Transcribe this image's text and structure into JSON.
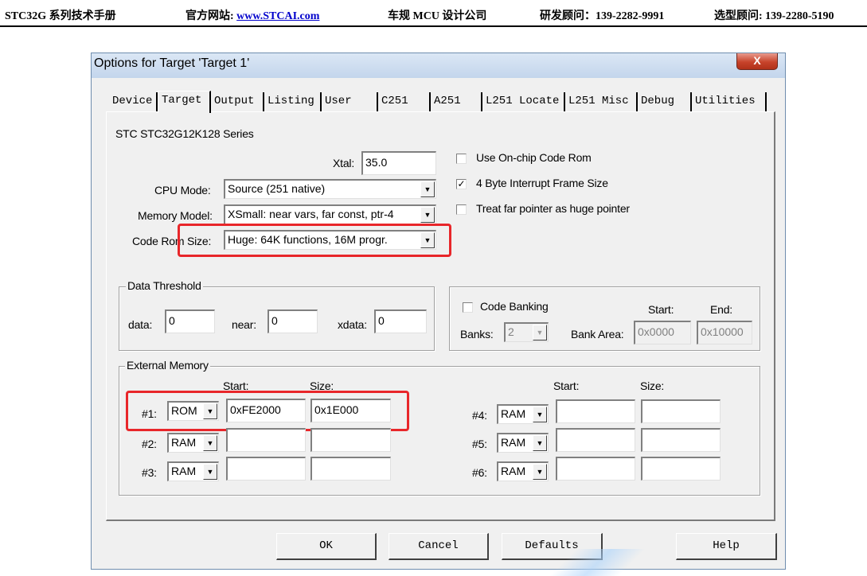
{
  "doc_header": {
    "title": "STC32G 系列技术手册",
    "website_label": "官方网站: ",
    "website_url": "www.STCAI.com",
    "company": "车规 MCU 设计公司",
    "rd_consultant": "研发顾问：139-2282-9991",
    "selection_consultant": "选型顾问: 139-2280-5190"
  },
  "dialog": {
    "title": "Options for Target 'Target 1'",
    "close_label": "X"
  },
  "tabs": [
    {
      "label": "Device"
    },
    {
      "label": "Target",
      "active": true
    },
    {
      "label": "Output"
    },
    {
      "label": "Listing"
    },
    {
      "label": "User"
    },
    {
      "label": "C251"
    },
    {
      "label": "A251"
    },
    {
      "label": "L251 Locate"
    },
    {
      "label": "L251 Misc"
    },
    {
      "label": "Debug"
    },
    {
      "label": "Utilities"
    }
  ],
  "target": {
    "device_name": "STC STC32G12K128 Series",
    "xtal_label": "Xtal:",
    "xtal_value": "35.0",
    "cpu_mode_label": "CPU Mode:",
    "cpu_mode_value": "Source (251 native)",
    "memory_model_label": "Memory Model:",
    "memory_model_value": "XSmall: near vars, far const, ptr-4",
    "code_rom_size_label": "Code Rom Size:",
    "code_rom_size_value": "Huge: 64K functions, 16M progr.",
    "options": {
      "use_onchip_code_rom": {
        "label": "Use On-chip Code Rom",
        "checked": false
      },
      "four_byte_interrupt": {
        "label": "4 Byte Interrupt Frame Size",
        "checked": true
      },
      "treat_far_pointer": {
        "label": "Treat far pointer as huge pointer",
        "checked": false
      }
    },
    "data_threshold": {
      "title": "Data Threshold",
      "data_label": "data:",
      "data_value": "0",
      "near_label": "near:",
      "near_value": "0",
      "xdata_label": "xdata:",
      "xdata_value": "0"
    },
    "code_banking": {
      "label": "Code Banking",
      "checked": false,
      "banks_label": "Banks:",
      "banks_value": "2",
      "bank_area_label": "Bank Area:",
      "start_header": "Start:",
      "end_header": "End:",
      "start_value": "0x0000",
      "end_value": "0x10000"
    },
    "external_memory": {
      "title": "External Memory",
      "start_header": "Start:",
      "size_header": "Size:",
      "rows": [
        {
          "label": "#1:",
          "type": "ROM",
          "start": "0xFE2000",
          "size": "0x1E000"
        },
        {
          "label": "#2:",
          "type": "RAM",
          "start": "",
          "size": ""
        },
        {
          "label": "#3:",
          "type": "RAM",
          "start": "",
          "size": ""
        },
        {
          "label": "#4:",
          "type": "RAM",
          "start": "",
          "size": ""
        },
        {
          "label": "#5:",
          "type": "RAM",
          "start": "",
          "size": ""
        },
        {
          "label": "#6:",
          "type": "RAM",
          "start": "",
          "size": ""
        }
      ]
    }
  },
  "buttons": {
    "ok": "OK",
    "cancel": "Cancel",
    "defaults": "Defaults",
    "help": "Help"
  },
  "colors": {
    "highlight": "#e8262a",
    "dialog_bg": "#f0f0f0",
    "link": "#0000cc"
  }
}
